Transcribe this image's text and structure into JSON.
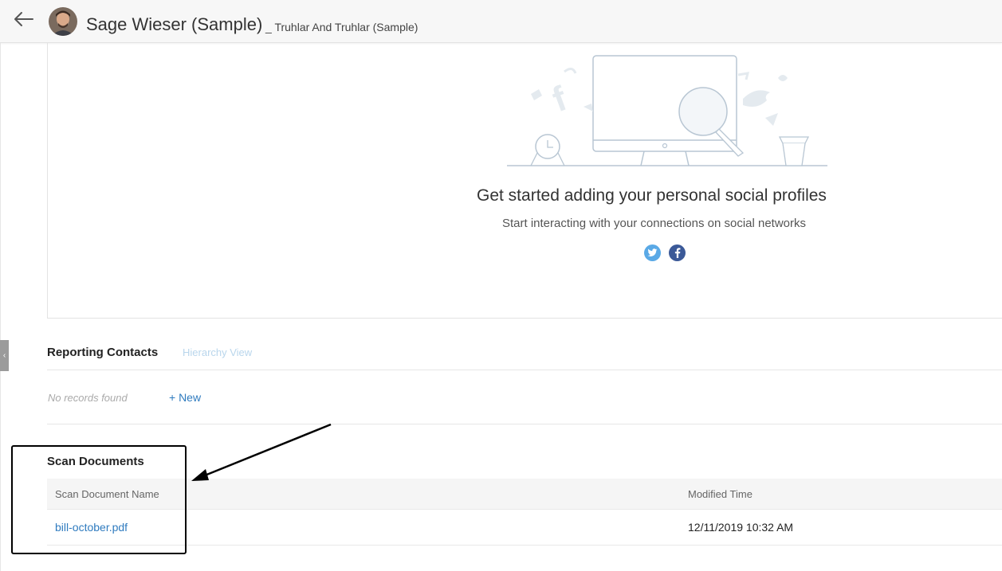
{
  "header": {
    "contact_name": "Sage Wieser (Sample)",
    "account_separator": "_",
    "account_name": "Truhlar And Truhlar (Sample)",
    "back_icon": "arrow-left-icon",
    "avatar_icon": "avatar"
  },
  "social": {
    "title": "Get started adding your personal social profiles",
    "subtitle": "Start interacting with your connections on social networks",
    "twitter_icon": "twitter-icon",
    "facebook_icon": "facebook-icon"
  },
  "reporting_contacts": {
    "title": "Reporting Contacts",
    "hierarchy_link": "Hierarchy View",
    "empty_text": "No records found",
    "new_label": "+ New"
  },
  "scan_documents": {
    "title": "Scan Documents",
    "columns": [
      "Scan Document Name",
      "Modified Time"
    ],
    "rows": [
      {
        "name": "bill-october.pdf",
        "modified": "12/11/2019 10:32 AM"
      }
    ]
  },
  "colors": {
    "link": "#2f7bbf",
    "twitter": "#5aa9e6",
    "facebook": "#3b5998",
    "header_bg": "#f7f7f7"
  }
}
